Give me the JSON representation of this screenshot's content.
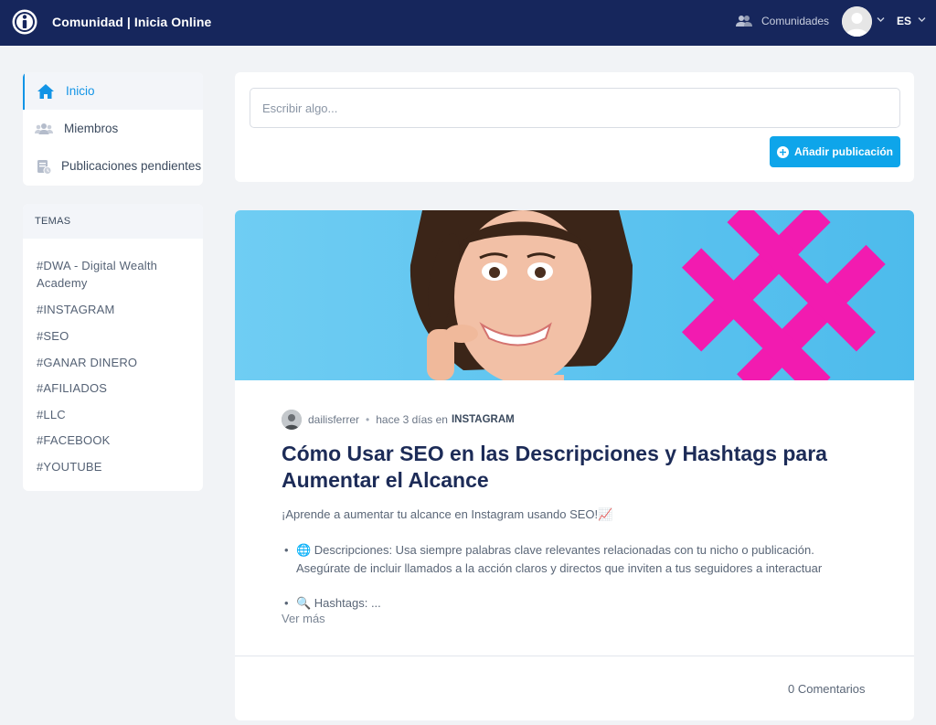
{
  "header": {
    "brand": "Comunidad | Inicia Online",
    "communities_label": "Comunidades",
    "language": "ES"
  },
  "nav": {
    "items": [
      {
        "label": "Inicio",
        "icon": "home-icon",
        "active": true
      },
      {
        "label": "Miembros",
        "icon": "members-icon",
        "active": false
      },
      {
        "label": "Publicaciones pendientes",
        "icon": "pending-posts-icon",
        "active": false
      }
    ]
  },
  "topics": {
    "heading": "TEMAS",
    "items": [
      "#DWA - Digital Wealth Academy",
      "#INSTAGRAM",
      "#SEO",
      "#GANAR DINERO",
      "#AFILIADOS",
      "#LLC",
      "#FACEBOOK",
      "#YOUTUBE"
    ]
  },
  "composer": {
    "placeholder": "Escribir algo...",
    "add_button": "Añadir publicación"
  },
  "post": {
    "author": "dailisferrer",
    "time": "hace 3 días en",
    "category": "INSTAGRAM",
    "title": "Cómo Usar SEO en las Descripciones y Hashtags para Aumentar el Alcance",
    "intro": "¡Aprende a aumentar tu alcance en Instagram usando SEO!📈",
    "bullets": [
      "🌐 Descripciones: Usa siempre palabras clave relevantes relacionadas con tu nicho o publicación. Asegúrate de incluir llamados a la acción claros y directos que inviten a tus seguidores a interactuar",
      "🔍 Hashtags: ..."
    ],
    "read_more": "Ver más",
    "comments": "0 Comentarios"
  },
  "colors": {
    "topbar": "#16265c",
    "accent": "#1294e6",
    "button": "#0ea5ea",
    "title": "#1c2b57",
    "hero_bg": "#5ec4ee",
    "hashtag": "#f21bb0"
  }
}
